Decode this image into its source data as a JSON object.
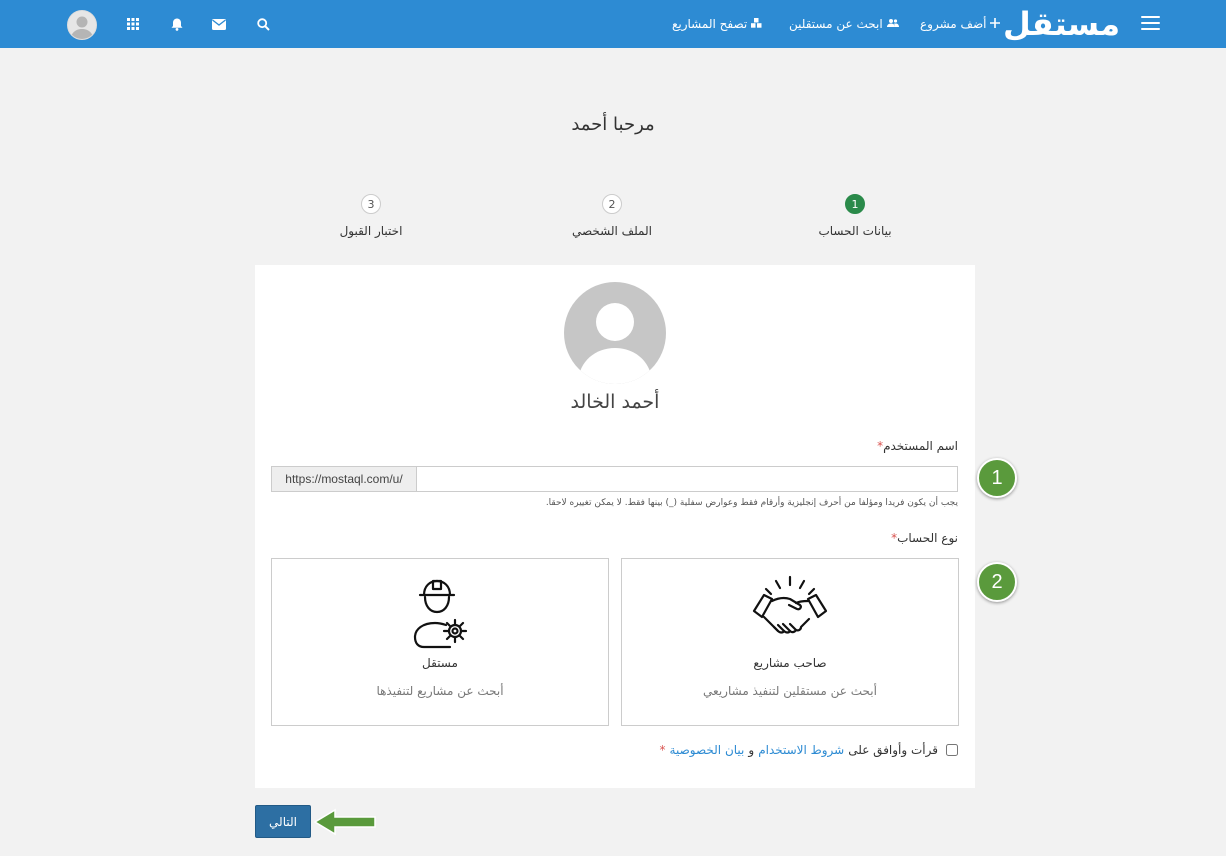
{
  "header": {
    "logo": "مستقل",
    "nav": {
      "add_project": "أضف مشروع",
      "find_freelancers": "ابحث عن مستقلين",
      "browse_projects": "تصفح المشاريع"
    },
    "icons": [
      "menu-icon",
      "plus-icon",
      "users-icon",
      "cubes-icon",
      "search-icon",
      "envelope-icon",
      "bell-icon",
      "apps-grid-icon",
      "avatar"
    ]
  },
  "page": {
    "welcome": "مرحبا أحمد"
  },
  "steps": [
    {
      "number": "1",
      "label": "بيانات الحساب",
      "active": true
    },
    {
      "number": "2",
      "label": "الملف الشخصي",
      "active": false
    },
    {
      "number": "3",
      "label": "اختبار القبول",
      "active": false
    }
  ],
  "form": {
    "profile_name": "أحمد الخالد",
    "username_label": "اسم المستخدم",
    "required_mark": "*",
    "username_prefix": "https://mostaql.com/u/",
    "username_value": "",
    "username_help": "يجب أن يكون فريدا ومؤلفا من أحرف إنجليزية وأرقام فقط وعوارض سفلية (_) بينها فقط. لا يمكن تغييره لاحقا.",
    "account_type_label": "نوع الحساب",
    "account_types": [
      {
        "title": "صاحب مشاريع",
        "description": "أبحث عن مستقلين لتنفيذ مشاريعي",
        "icon": "handshake-icon"
      },
      {
        "title": "مستقل",
        "description": "أبحث عن مشاريع لتنفيذها",
        "icon": "worker-gear-icon"
      }
    ],
    "agree_prefix": "قرأت وأوافق على",
    "terms_link": "شروط الاستخدام",
    "agree_and": "و",
    "privacy_link": "بيان الخصوصية",
    "agree_checked": false
  },
  "actions": {
    "next": "التالي"
  },
  "annotations": {
    "badge_1": "1",
    "badge_2": "2"
  },
  "colors": {
    "header": "#2d8bd3",
    "active_step": "#2a8a4a",
    "next_button": "#2d6fa3",
    "badge": "#5a9a3c"
  }
}
